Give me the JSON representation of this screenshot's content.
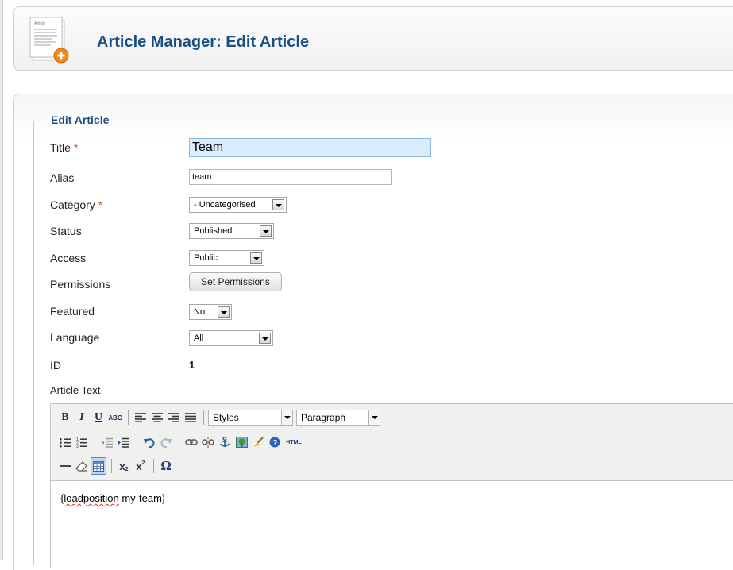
{
  "header": {
    "title": "Article Manager: Edit Article",
    "icon": "article-add-icon",
    "icon_text": "Article"
  },
  "form": {
    "legend": "Edit Article",
    "required_mark": "*",
    "fields": {
      "title": {
        "label": "Title",
        "value": "Team"
      },
      "alias": {
        "label": "Alias",
        "value": "team"
      },
      "category": {
        "label": "Category",
        "value": "- Uncategorised"
      },
      "status": {
        "label": "Status",
        "value": "Published"
      },
      "access": {
        "label": "Access",
        "value": "Public"
      },
      "permissions": {
        "label": "Permissions",
        "button": "Set Permissions"
      },
      "featured": {
        "label": "Featured",
        "value": "No"
      },
      "language": {
        "label": "Language",
        "value": "All"
      },
      "id": {
        "label": "ID",
        "value": "1"
      }
    },
    "article_text_label": "Article Text"
  },
  "editor": {
    "toolbar": {
      "bold": "B",
      "italic": "I",
      "underline": "U",
      "strike": "ABC",
      "styles": "Styles",
      "paragraph": "Paragraph",
      "subscript": "x",
      "superscript": "x",
      "omega": "Ω",
      "html": "HTML"
    },
    "content_prefix": "{",
    "content_word": "loadposition",
    "content_suffix": " my-team}"
  },
  "colors": {
    "title_blue": "#1a4f86",
    "required_star": "#e0501c",
    "active_field": "#d8ecfb"
  }
}
